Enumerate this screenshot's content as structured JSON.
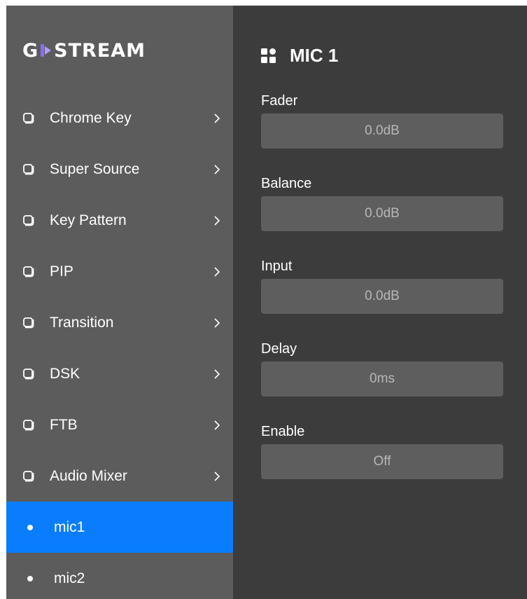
{
  "logo": {
    "left": "G",
    "right": "STREAM"
  },
  "sidebar": {
    "items": [
      {
        "label": "Chrome Key"
      },
      {
        "label": "Super Source"
      },
      {
        "label": "Key Pattern"
      },
      {
        "label": "PIP"
      },
      {
        "label": "Transition"
      },
      {
        "label": "DSK"
      },
      {
        "label": "FTB"
      },
      {
        "label": "Audio Mixer"
      }
    ],
    "sub_items": [
      {
        "label": "mic1",
        "active": true
      },
      {
        "label": "mic2",
        "active": false
      }
    ],
    "active_color": "#0a7dff"
  },
  "panel": {
    "title": "MIC 1",
    "fields": [
      {
        "label": "Fader",
        "value": "0.0dB"
      },
      {
        "label": "Balance",
        "value": "0.0dB"
      },
      {
        "label": "Input",
        "value": "0.0dB"
      },
      {
        "label": "Delay",
        "value": "0ms"
      },
      {
        "label": "Enable",
        "value": "Off"
      }
    ]
  },
  "icons": {
    "menu_item": "rounded-square-icon",
    "chevron": "chevron-right-icon",
    "title": "grid-icon"
  }
}
